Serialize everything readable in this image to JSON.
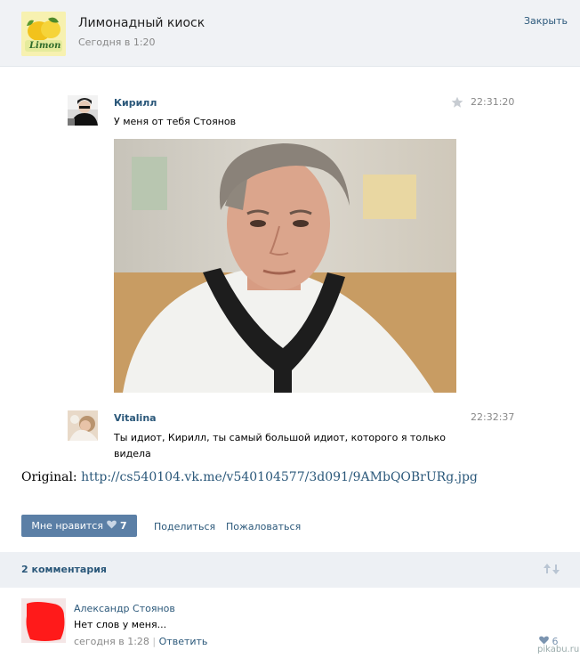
{
  "header": {
    "title": "Лимонадный киоск",
    "time": "Сегодня в 1:20",
    "close_label": "Закрыть",
    "logo_text": "Limon"
  },
  "messages": [
    {
      "author": "Кирилл",
      "time": "22:31:20",
      "text": "У меня от тебя Стоянов"
    },
    {
      "author": "Vitalina",
      "time": "22:32:37",
      "text_line1": "Ты идиот, Кирилл, ты самый большой идиот, которого я только",
      "text_line2": "видела"
    }
  ],
  "original": {
    "label": "Original:",
    "url": "http://cs540104.vk.me/v540104577/3d091/9AMbQOBrURg.jpg"
  },
  "actions": {
    "like_label": "Мне нравится",
    "like_count": "7",
    "share_label": "Поделиться",
    "report_label": "Пожаловаться"
  },
  "comments": {
    "count_label": "2 комментария",
    "items": [
      {
        "author": "Александр Стоянов",
        "text": "Нет слов у меня...",
        "time": "сегодня в 1:28",
        "separator": "|",
        "reply_label": "Ответить",
        "likes": "6"
      }
    ]
  },
  "watermark": "pikabu.ru",
  "colors": {
    "link": "#2b587a",
    "button": "#5b7fa6",
    "header_bg": "#f0f2f5"
  },
  "icons": [
    "star-icon",
    "heart-icon",
    "sort-arrows-icon",
    "lemon-logo-icon"
  ]
}
